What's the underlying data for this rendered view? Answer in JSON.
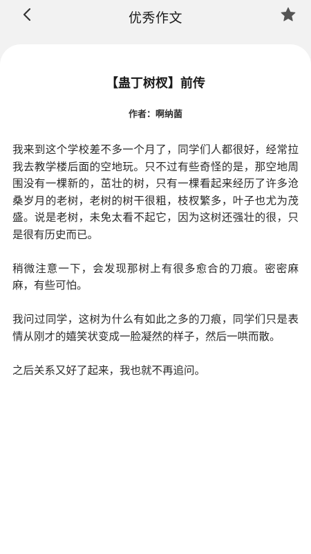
{
  "header": {
    "title": "优秀作文",
    "back_icon": "chevron-left-icon",
    "favorite_icon": "star-icon",
    "icon_color": "#555555"
  },
  "article": {
    "title": "【蛊丁树杈】前传",
    "author_label": "作者：",
    "author_name": "啊纳菌",
    "paragraphs": [
      "我来到这个学校差不多一个月了，同学们人都很好，经常拉我去教学楼后面的空地玩。只不过有些奇怪的是，那空地周围没有一棵新的，茁壮的树，只有一棵看起来经历了许多沧桑岁月的老树，老树的树干很粗，枝杈繁多，叶子也尤为茂盛。说是老树，未免太看不起它，因为这树还强壮的很，只是很有历史而已。",
      "稍微注意一下，会发现那树上有很多愈合的刀痕。密密麻麻，有些可怕。",
      "我问过同学，这树为什么有如此之多的刀痕，同学们只是表情从刚才的嬉笑状变成一脸凝然的样子，然后一哄而散。",
      "之后关系又好了起来，我也就不再追问。"
    ]
  },
  "colors": {
    "background": "#f2f2f2",
    "card": "#ffffff"
  }
}
